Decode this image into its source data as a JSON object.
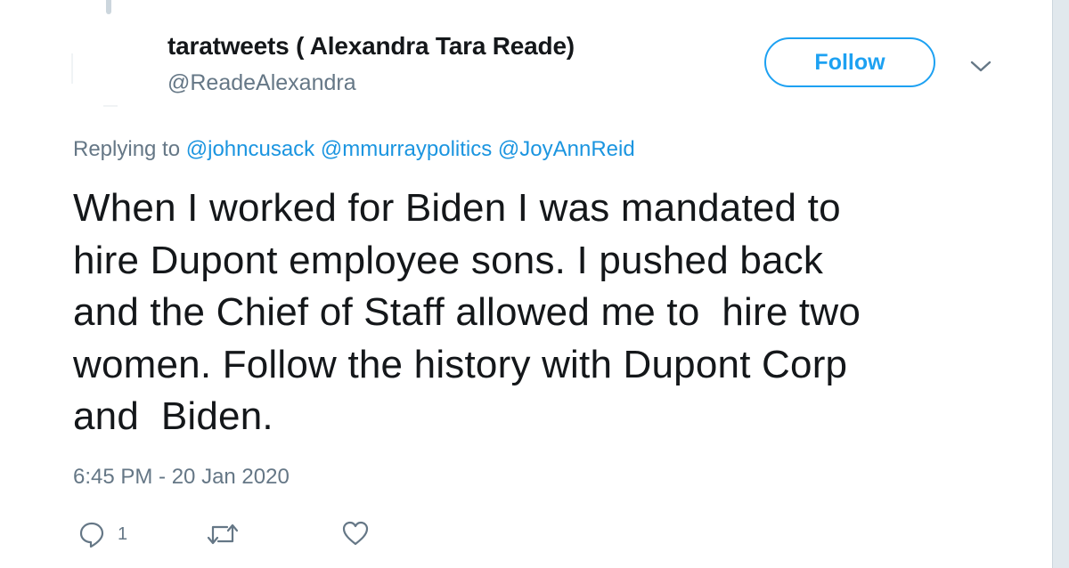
{
  "tweet": {
    "display_name": "taratweets ( Alexandra Tara Reade)",
    "handle": "@ReadeAlexandra",
    "follow_label": "Follow",
    "replying_prefix": "Replying to",
    "mentions": [
      "@johncusack",
      "@mmurraypolitics",
      "@JoyAnnReid"
    ],
    "text_lines": [
      "When I worked for Biden I was mandated to",
      "hire Dupont employee sons. I pushed back",
      "and the Chief of Staff allowed me to  hire two",
      "women. Follow the history with Dupont Corp",
      "and  Biden."
    ],
    "timestamp": "6:45 PM - 20 Jan 2020",
    "reply_count": "1"
  },
  "icons": {
    "reply": "reply-bubble-icon",
    "retweet": "retweet-icon",
    "like": "heart-icon",
    "caret": "chevron-down-icon"
  },
  "colors": {
    "accent": "#1da1f2",
    "mention": "#1b95e0",
    "secondary_text": "#657786",
    "primary_text": "#14171a"
  }
}
